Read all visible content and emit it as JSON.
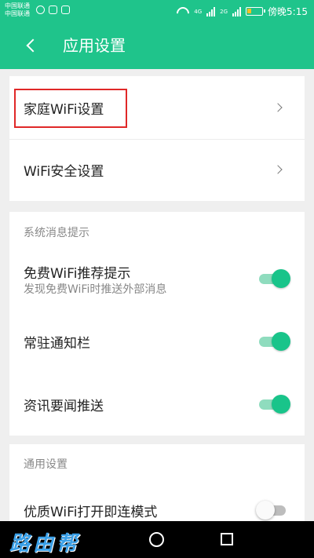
{
  "status_bar": {
    "carrier_line1": "中国联通",
    "carrier_line2": "中国联通",
    "network_1": "4G",
    "network_2": "2G",
    "time": "傍晚5:15"
  },
  "app_bar": {
    "title": "应用设置"
  },
  "wifi_section": {
    "items": [
      {
        "label": "家庭WiFi设置"
      },
      {
        "label": "WiFi安全设置"
      }
    ]
  },
  "notifications_section": {
    "title": "系统消息提示",
    "items": [
      {
        "label": "免费WiFi推荐提示",
        "subtitle": "发现免费WiFi时推送外部消息",
        "enabled": true
      },
      {
        "label": "常驻通知栏",
        "enabled": true
      },
      {
        "label": "资讯要闻推送",
        "enabled": true
      }
    ]
  },
  "general_section": {
    "title": "通用设置",
    "items": [
      {
        "label": "优质WiFi打开即连模式",
        "enabled": false
      }
    ]
  },
  "nav_bar": {
    "watermark": "路由帮"
  },
  "colors": {
    "accent": "#1fc48b",
    "highlight_border": "#e02828"
  }
}
